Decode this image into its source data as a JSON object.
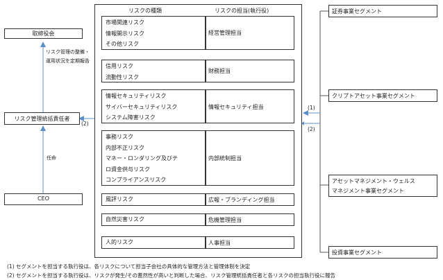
{
  "left": {
    "board": "取締役会",
    "report_note": [
      "リスク管理の整備・",
      "運用状況を定期報告"
    ],
    "officer": "リスク管理統括責任者",
    "appoint": "任命",
    "ceo": "CEO"
  },
  "center": {
    "col_risk_type": "リスクの種類",
    "col_owner": "リスクの担当(執行役)",
    "rows": [
      {
        "risks": [
          "市場関連リスク",
          "情報開示リスク",
          "その他リスク"
        ],
        "owner": "経営管理担当"
      },
      {
        "risks": [
          "信用リスク",
          "流動性リスク"
        ],
        "owner": "財務担当"
      },
      {
        "risks": [
          "情報セキュリティリスク",
          "サイバーセキュリティリスク",
          "システム障害リスク"
        ],
        "owner": "情報セキュリティ担当"
      },
      {
        "risks": [
          "事務リスク",
          "内部不正リスク",
          "マネー・ロンダリング及びテ",
          "ロ資金供与リスク",
          "コンプライアンスリスク"
        ],
        "owner": "内部統制担当"
      },
      {
        "risks": [
          "風評リスク"
        ],
        "owner": "広報・ブランディング担当"
      },
      {
        "risks": [
          "自然災害リスク"
        ],
        "owner": "危機管理担当"
      },
      {
        "risks": [
          "人的リスク"
        ],
        "owner": "人事担当"
      }
    ]
  },
  "arrows": {
    "label_1": "(1)",
    "label_2": "(2)",
    "label_2_left": "(2)"
  },
  "segments": [
    {
      "lines": [
        "証券事業セグメント"
      ]
    },
    {
      "lines": [
        "クリプトアセット事業セグメント"
      ]
    },
    {
      "lines": [
        "アセットマネジメント・ウェルス",
        "マネジメント事業セグメント"
      ]
    },
    {
      "lines": [
        "投資事業セグメント"
      ]
    }
  ],
  "notes": [
    "(1) セグメントを担当する執行役は、各リスクについて担当子会社の具体的な管理方法と管理体制を決定",
    "(2) セグメントを担当する執行役は、リスクが発生/その蓋然性が高いと判断した場合、リスク管理統括責任者と各リスクの担当執行役に報告"
  ],
  "colors": {
    "arrow": "#5b8fc9",
    "border": "#333333"
  }
}
